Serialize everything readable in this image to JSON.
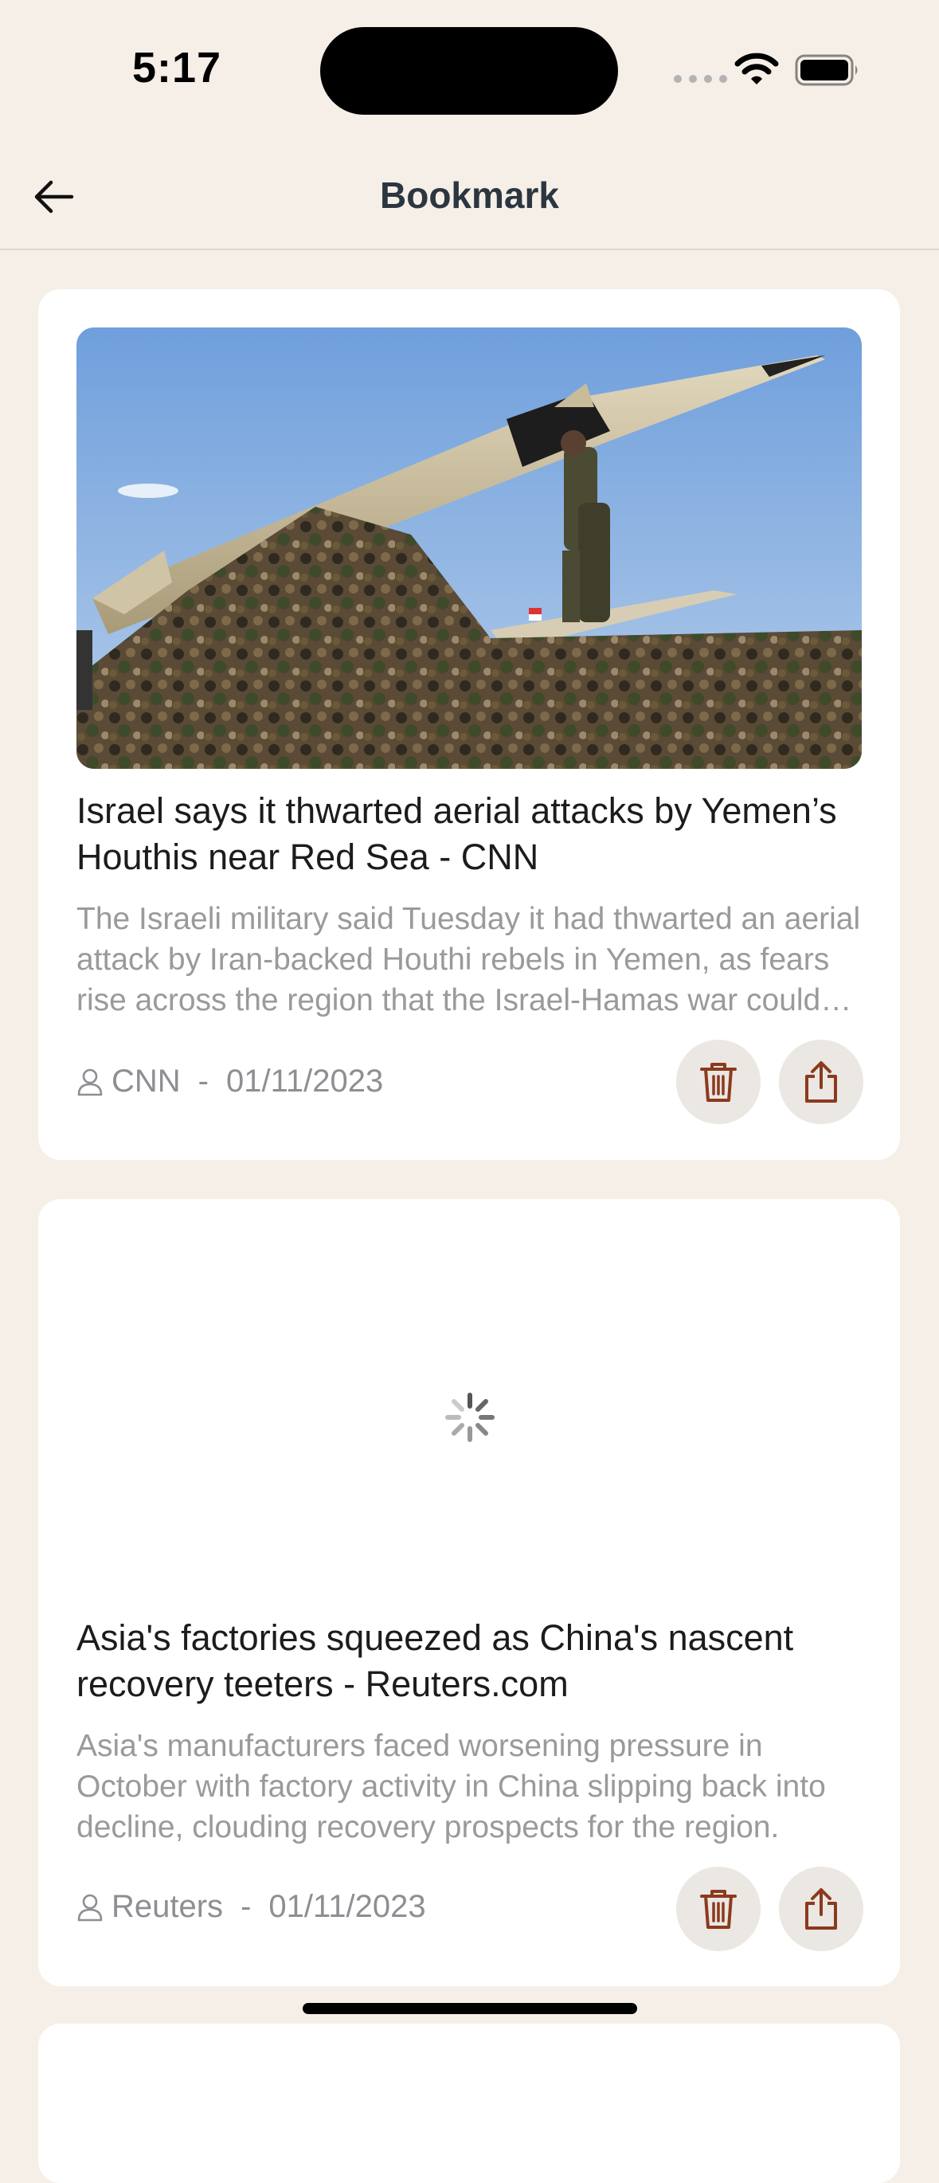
{
  "status_bar": {
    "time": "5:17"
  },
  "header": {
    "title": "Bookmark"
  },
  "articles": [
    {
      "headline": "Israel says it thwarted aerial attacks by Yemen’s Houthis near Red Sea - CNN",
      "description": "The Israeli military said Tuesday it had thwarted an aerial attack by Iran-backed Houthi rebels in Yemen, as fears rise across the region that the Israel-Hamas war could spread.",
      "source": "CNN",
      "date": "01/11/2023",
      "image": "missile-photo"
    },
    {
      "headline": "Asia's factories squeezed as China's nascent recovery teeters - Reuters.com",
      "description": "Asia's manufacturers faced worsening pressure in October with factory activity in China slipping back into decline, clouding recovery prospects for the region.",
      "source": "Reuters",
      "date": "01/11/2023",
      "image": "loading-spinner"
    }
  ],
  "separator": "-",
  "icons": {
    "back": "arrow-left-icon",
    "delete": "trash-icon",
    "share": "share-icon",
    "author": "person-icon"
  },
  "colors": {
    "background": "#f5efe8",
    "card": "#ffffff",
    "action_icon": "#8b3a1e",
    "button_bg": "#ebe7e3"
  }
}
